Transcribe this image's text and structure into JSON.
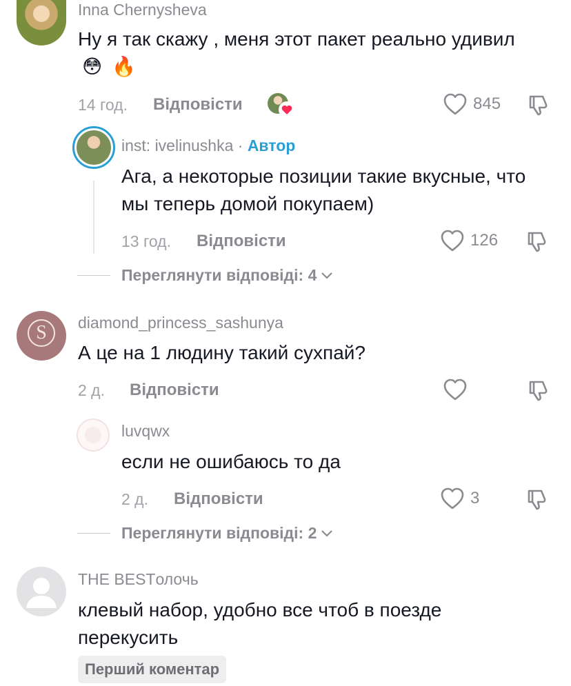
{
  "comments": [
    {
      "username": "Inna Chernysheva",
      "text": "Ну я так скажу , меня этот пакет реально удивил",
      "emojis": [
        "😳",
        "🔥"
      ],
      "time": "14 год.",
      "reply_label": "Відповісти",
      "likes": "845",
      "view_replies": "Переглянути відповіді: 4",
      "replies": [
        {
          "username": "inst: ivelinushka",
          "separator": " · ",
          "author_badge": "Автор",
          "text": "Ага, а некоторые позиции такие вкусные, что мы теперь домой покупаем)",
          "time": "13 год.",
          "reply_label": "Відповісти",
          "likes": "126"
        }
      ]
    },
    {
      "username": "diamond_princess_sashunya",
      "avatar_letter": "S",
      "text": "А це на 1 людину такий сухпай?",
      "time": "2 д.",
      "reply_label": "Відповісти",
      "likes": "",
      "view_replies": "Переглянути відповіді: 2",
      "replies": [
        {
          "username": "luvqwx",
          "text": "если не ошибаюсь то да",
          "time": "2 д.",
          "reply_label": "Відповісти",
          "likes": "3"
        }
      ]
    },
    {
      "username": "THE BESTолочь",
      "text": "клевый набор, удобно все чтоб в поезде перекусить",
      "first_comment_badge": "Перший коментар"
    }
  ],
  "colors": {
    "author": "#2a9fd6",
    "liked_heart": "#fe2c55",
    "muted": "#8a8b91"
  }
}
